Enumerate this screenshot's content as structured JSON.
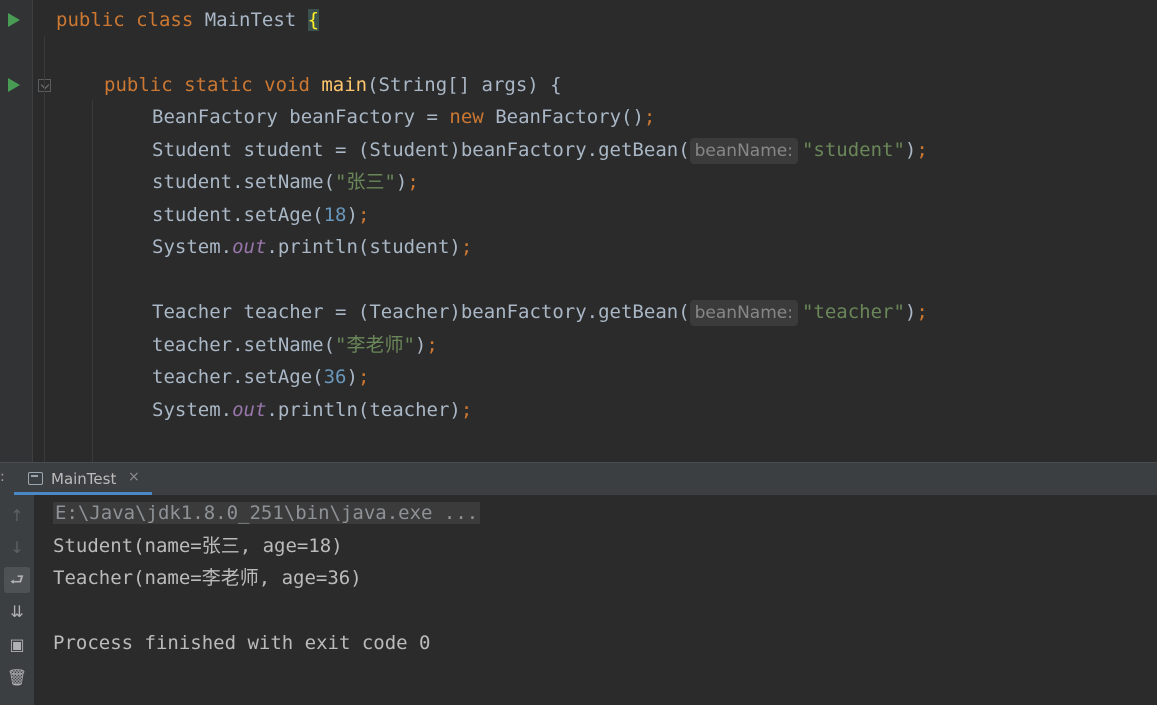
{
  "editor": {
    "lines": {
      "l1": {
        "kw": "public class ",
        "cls": "MainTest ",
        "brace": "{"
      },
      "l3": {
        "kw": "public static void ",
        "fn": "main",
        "rest": "(String[] args) {"
      },
      "l4": {
        "a": "BeanFactory beanFactory = ",
        "kw": "new ",
        "b": "BeanFactory()",
        "semi": ";"
      },
      "l5": {
        "a": "Student student = (Student)beanFactory.getBean(",
        "hint": "beanName:",
        "str": "\"student\"",
        "b": ")",
        "semi": ";"
      },
      "l6": {
        "a": "student.setName(",
        "str": "\"张三\"",
        "b": ")",
        "semi": ";"
      },
      "l7": {
        "a": "student.setAge(",
        "num": "18",
        "b": ")",
        "semi": ";"
      },
      "l8": {
        "a": "System.",
        "fld": "out",
        "b": ".println(student)",
        "semi": ";"
      },
      "l10": {
        "a": "Teacher teacher = (Teacher)beanFactory.getBean(",
        "hint": "beanName:",
        "str": "\"teacher\"",
        "b": ")",
        "semi": ";"
      },
      "l11": {
        "a": "teacher.setName(",
        "str": "\"李老师\"",
        "b": ")",
        "semi": ";"
      },
      "l12": {
        "a": "teacher.setAge(",
        "num": "36",
        "b": ")",
        "semi": ";"
      },
      "l13": {
        "a": "System.",
        "fld": "out",
        "b": ".println(teacher)",
        "semi": ";"
      }
    }
  },
  "run_panel": {
    "tab_label": "MainTest",
    "tab_close": "×",
    "left_marker": ":",
    "console": [
      "E:\\Java\\jdk1.8.0_251\\bin\\java.exe ...",
      "Student(name=张三, age=18)",
      "Teacher(name=李老师, age=36)",
      "",
      "Process finished with exit code 0"
    ],
    "toolbar_icons": {
      "up": "↑",
      "down": "↓",
      "wrap": "⮐",
      "scroll": "⇊",
      "print": "▣",
      "trash": "🗑"
    }
  },
  "colors": {
    "keyword": "#cc7832",
    "function": "#ffc66d",
    "string": "#6a8759",
    "number": "#6897bb",
    "field": "#9876aa",
    "text": "#a9b7c6",
    "run": "#499c54"
  }
}
